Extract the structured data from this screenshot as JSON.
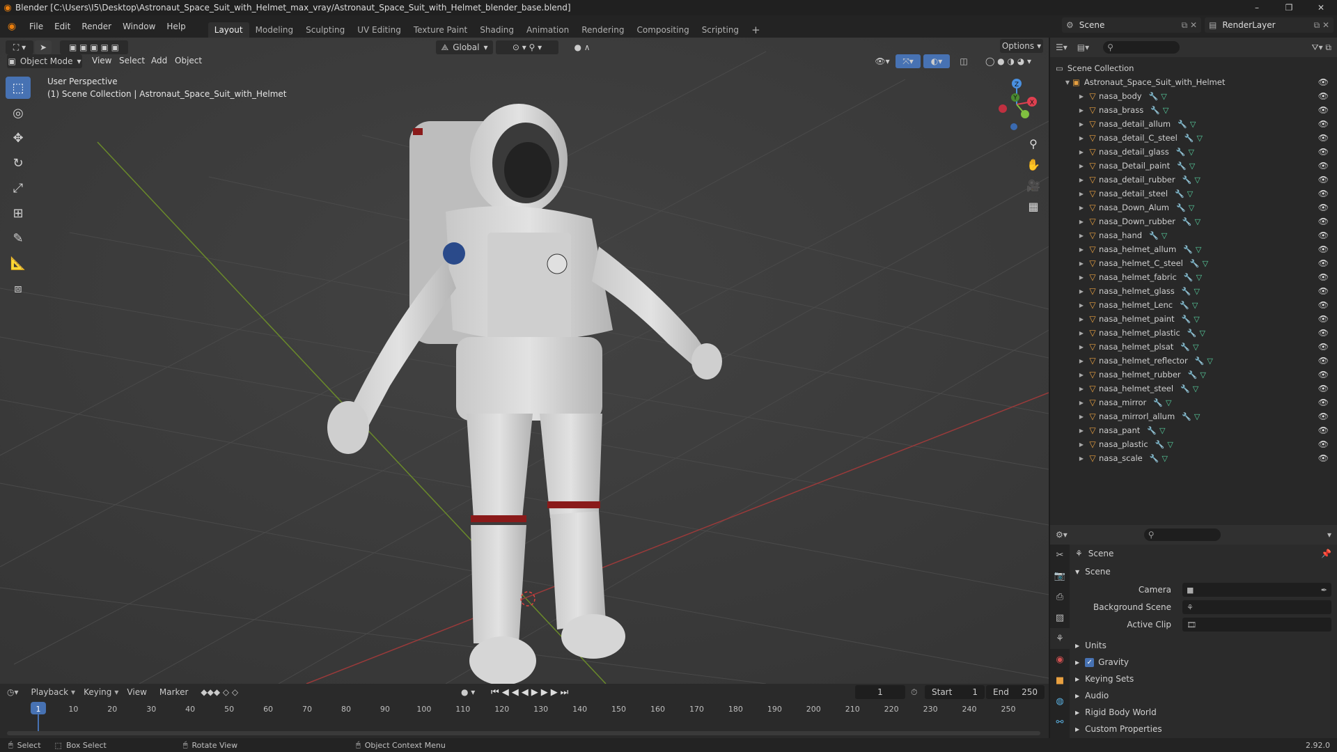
{
  "window": {
    "title": "Blender [C:\\Users\\I5\\Desktop\\Astronaut_Space_Suit_with_Helmet_max_vray/Astronaut_Space_Suit_with_Helmet_blender_base.blend]",
    "minimize": "–",
    "maximize": "❐",
    "close": "✕"
  },
  "menu": [
    "File",
    "Edit",
    "Render",
    "Window",
    "Help"
  ],
  "workspaces": [
    {
      "label": "Layout",
      "active": true
    },
    {
      "label": "Modeling"
    },
    {
      "label": "Sculpting"
    },
    {
      "label": "UV Editing"
    },
    {
      "label": "Texture Paint"
    },
    {
      "label": "Shading"
    },
    {
      "label": "Animation"
    },
    {
      "label": "Rendering"
    },
    {
      "label": "Compositing"
    },
    {
      "label": "Scripting"
    }
  ],
  "add_workspace": "+",
  "scene_selector": {
    "label": "Scene"
  },
  "render_layer": {
    "label": "RenderLayer"
  },
  "viewport": {
    "mode": "Object Mode",
    "menus": [
      "View",
      "Select",
      "Add",
      "Object"
    ],
    "orientation": "Global",
    "options": "Options",
    "overlay_title": "User Perspective",
    "overlay_sub": "(1) Scene Collection | Astronaut_Space_Suit_with_Helmet",
    "gizmo": {
      "x": "X",
      "y": "Y",
      "z": "Z"
    }
  },
  "outliner": {
    "root": "Scene Collection",
    "collection": "Astronaut_Space_Suit_with_Helmet",
    "objects": [
      "nasa_body",
      "nasa_brass",
      "nasa_detail_allum",
      "nasa_detail_C_steel",
      "nasa_detail_glass",
      "nasa_Detail_paint",
      "nasa_detail_rubber",
      "nasa_detail_steel",
      "nasa_Down_Alum",
      "nasa_Down_rubber",
      "nasa_hand",
      "nasa_helmet_allum",
      "nasa_helmet_C_steel",
      "nasa_helmet_fabric",
      "nasa_helmet_glass",
      "nasa_helmet_Lenc",
      "nasa_helmet_paint",
      "nasa_helmet_plastic",
      "nasa_helmet_plsat",
      "nasa_helmet_reflector",
      "nasa_helmet_rubber",
      "nasa_helmet_steel",
      "nasa_mirror",
      "nasa_mirrorl_allum",
      "nasa_pant",
      "nasa_plastic",
      "nasa_scale"
    ]
  },
  "properties": {
    "context": "Scene",
    "panel": "Scene",
    "camera_label": "Camera",
    "background_label": "Background Scene",
    "clip_label": "Active Clip",
    "sections": [
      "Units",
      "Gravity",
      "Keying Sets",
      "Audio",
      "Rigid Body World",
      "Custom Properties"
    ],
    "gravity_checked": true
  },
  "timeline": {
    "menus": [
      "Playback",
      "Keying",
      "View",
      "Marker"
    ],
    "current_frame": "1",
    "start_label": "Start",
    "start": "1",
    "end_label": "End",
    "end": "250",
    "ticks": [
      "1",
      "10",
      "20",
      "30",
      "40",
      "50",
      "60",
      "70",
      "80",
      "90",
      "100",
      "110",
      "120",
      "130",
      "140",
      "150",
      "160",
      "170",
      "180",
      "190",
      "200",
      "210",
      "220",
      "230",
      "240",
      "250"
    ]
  },
  "status": {
    "select": "Select",
    "box_select": "Box Select",
    "rotate": "Rotate View",
    "context_menu": "Object Context Menu",
    "version": "2.92.0"
  }
}
